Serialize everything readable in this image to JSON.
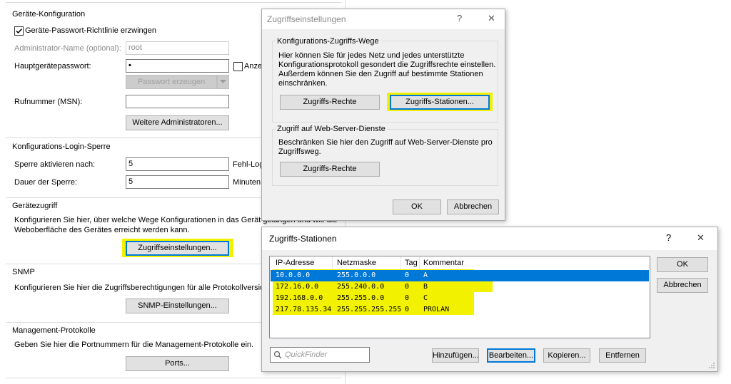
{
  "geraete_konfiguration": {
    "title": "Geräte-Konfiguration",
    "enforce_password_policy_label": "Geräte-Passwort-Richtlinie erzwingen",
    "admin_name_label": "Administrator-Name (optional):",
    "admin_name_value": "root",
    "main_password_label": "Hauptgerätepasswort:",
    "main_password_value": "•",
    "show_label": "Anzeig",
    "generate_password_label": "Passwort erzeugen",
    "phone_label": "Rufnummer (MSN):",
    "phone_value": "",
    "more_admins_label": "Weitere Administratoren..."
  },
  "login_sperre": {
    "title": "Konfigurations-Login-Sperre",
    "activate_after_label": "Sperre aktivieren nach:",
    "activate_after_value": "5",
    "activate_after_unit": "Fehl-Login",
    "duration_label": "Dauer der Sperre:",
    "duration_value": "5",
    "duration_unit": "Minuten"
  },
  "geraetezugriff": {
    "title": "Gerätezugriff",
    "description_line1": "Konfigurieren Sie hier, über welche Wege Konfigurationen in das Gerät gelangen und wie die",
    "description_line2": "Weboberfläche des Gerätes erreicht werden kann.",
    "access_settings_label": "Zugriffseinstellungen..."
  },
  "snmp": {
    "title": "SNMP",
    "description": "Konfigurieren Sie hier die Zugriffsberechtigungen für alle Protokollversionen v",
    "settings_label": "SNMP-Einstellungen..."
  },
  "management": {
    "title": "Management-Protokolle",
    "description": "Geben Sie hier die Portnummern für die Management-Protokolle ein.",
    "ports_label": "Ports..."
  },
  "zugriffseinstellungen_dialog": {
    "title": "Zugriffseinstellungen",
    "help": "?",
    "close": "✕",
    "group1_title": "Konfigurations-Zugriffs-Wege",
    "group1_text1": "Hier können Sie für jedes Netz und jedes unterstützte",
    "group1_text2": "Konfigurationsprotokoll gesondert die Zugriffsrechte einstellen.",
    "group1_text3": "Außerdem können Sie den Zugriff auf bestimmte Stationen",
    "group1_text4": "einschränken.",
    "rights_label": "Zugriffs-Rechte",
    "stations_label": "Zugriffs-Stationen...",
    "group2_title": "Zugriff auf Web-Server-Dienste",
    "group2_text1": "Beschränken Sie hier den Zugriff auf Web-Server-Dienste pro",
    "group2_text2": "Zugriffsweg.",
    "web_rights_label": "Zugriffs-Rechte",
    "ok_label": "OK",
    "cancel_label": "Abbrechen"
  },
  "stationen_dialog": {
    "title": "Zugriffs-Stationen",
    "help": "?",
    "close": "✕",
    "columns": [
      "IP-Adresse",
      "Netzmaske",
      "Tag",
      "Kommentar"
    ],
    "rows": [
      [
        "10.0.0.0",
        "255.0.0.0",
        "0",
        "A"
      ],
      [
        "172.16.0.0",
        "255.240.0.0",
        "0",
        "B"
      ],
      [
        "192.168.0.0",
        "255.255.0.0",
        "0",
        "C"
      ],
      [
        "217.78.135.34",
        "255.255.255.255",
        "0",
        "PROLAN"
      ]
    ],
    "ok_label": "OK",
    "cancel_label": "Abbrechen",
    "quickfinder_placeholder": "QuickFinder",
    "add_label": "Hinzufügen...",
    "edit_label": "Bearbeiten...",
    "copy_label": "Kopieren...",
    "remove_label": "Entfernen"
  },
  "colors": {
    "highlight": "#f2f200",
    "selection": "#0078d7",
    "dialog_bg": "#f0f0f0"
  }
}
